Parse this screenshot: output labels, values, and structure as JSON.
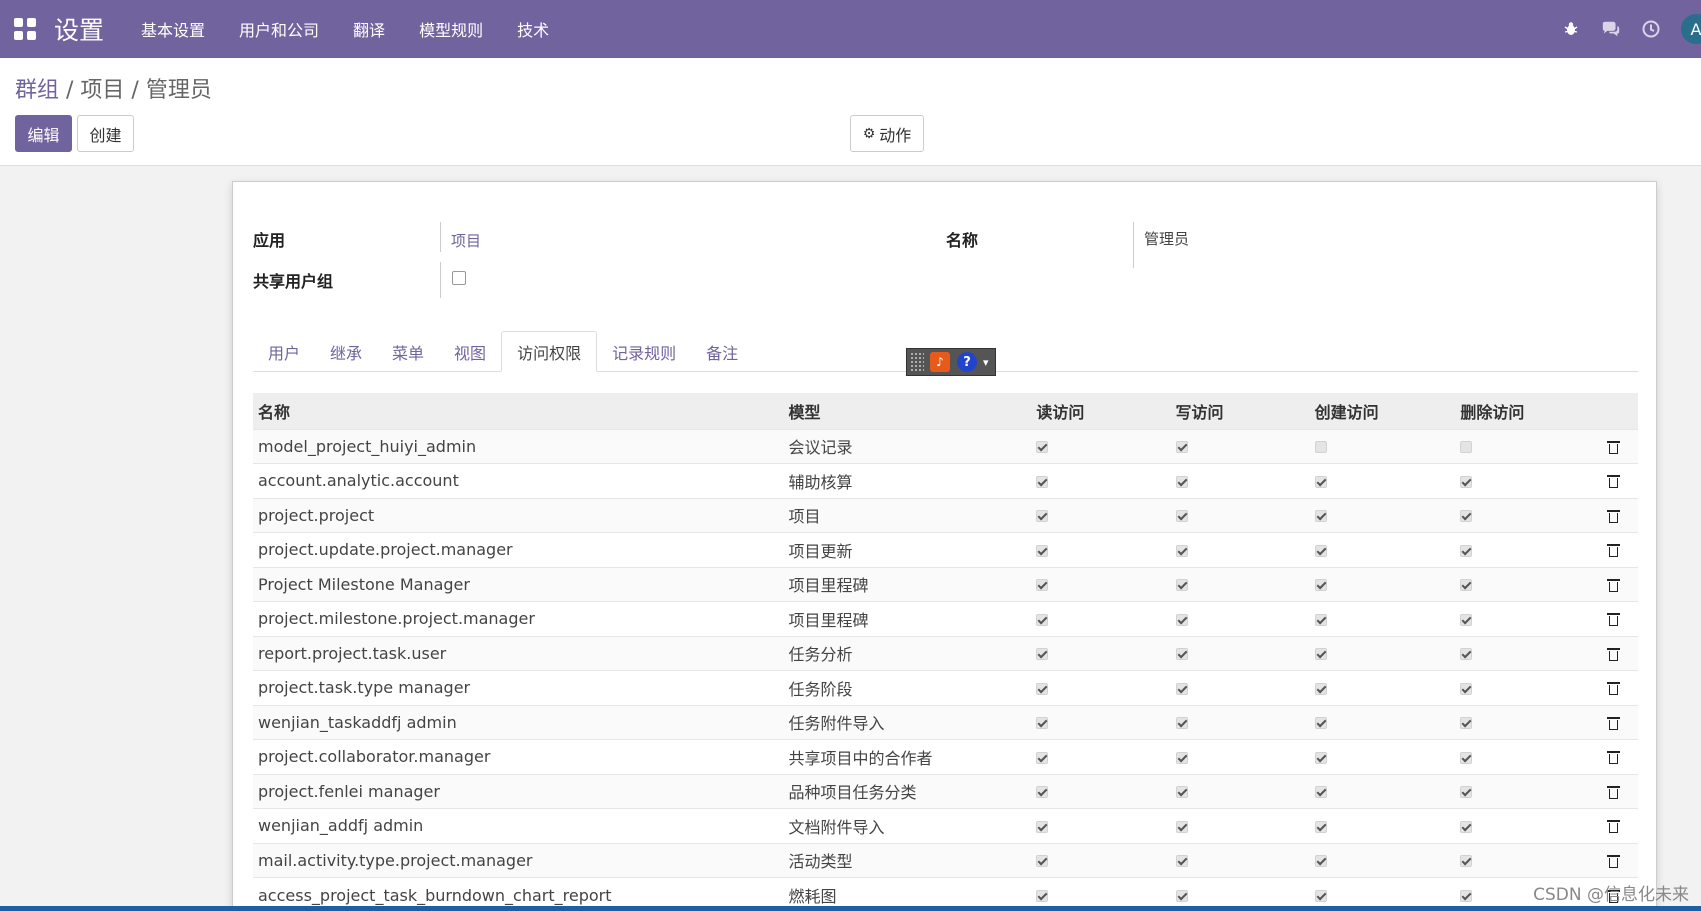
{
  "navbar": {
    "app_title": "设置",
    "menu": [
      "基本设置",
      "用户和公司",
      "翻译",
      "模型规则",
      "技术"
    ],
    "right_icons": [
      "bug-icon",
      "chat-icon",
      "clock-icon"
    ],
    "avatar_initial": "A",
    "color": "#71639e"
  },
  "breadcrumb": {
    "root": "群组",
    "sep1": " / ",
    "middle": "项目",
    "sep2": " / ",
    "current": "管理员"
  },
  "buttons": {
    "edit": "编辑",
    "create": "创建",
    "action": "动作"
  },
  "form": {
    "app_label": "应用",
    "app_value": "项目",
    "name_label": "名称",
    "name_value": "管理员",
    "shared_label": "共享用户组",
    "shared_checked": false
  },
  "tabs": [
    {
      "label": "用户",
      "active": false
    },
    {
      "label": "继承",
      "active": false
    },
    {
      "label": "菜单",
      "active": false
    },
    {
      "label": "视图",
      "active": false
    },
    {
      "label": "访问权限",
      "active": true
    },
    {
      "label": "记录规则",
      "active": false
    },
    {
      "label": "备注",
      "active": false
    }
  ],
  "table": {
    "headers": [
      "名称",
      "模型",
      "读访问",
      "写访问",
      "创建访问",
      "删除访问",
      ""
    ],
    "rows": [
      {
        "name": "model_project_huiyi_admin",
        "model": "会议记录",
        "read": true,
        "write": true,
        "create": false,
        "unlink": false
      },
      {
        "name": "account.analytic.account",
        "model": "辅助核算",
        "read": true,
        "write": true,
        "create": true,
        "unlink": true
      },
      {
        "name": "project.project",
        "model": "项目",
        "read": true,
        "write": true,
        "create": true,
        "unlink": true
      },
      {
        "name": "project.update.project.manager",
        "model": "项目更新",
        "read": true,
        "write": true,
        "create": true,
        "unlink": true
      },
      {
        "name": "Project Milestone Manager",
        "model": "项目里程碑",
        "read": true,
        "write": true,
        "create": true,
        "unlink": true
      },
      {
        "name": "project.milestone.project.manager",
        "model": "项目里程碑",
        "read": true,
        "write": true,
        "create": true,
        "unlink": true
      },
      {
        "name": "report.project.task.user",
        "model": "任务分析",
        "read": true,
        "write": true,
        "create": true,
        "unlink": true
      },
      {
        "name": "project.task.type manager",
        "model": "任务阶段",
        "read": true,
        "write": true,
        "create": true,
        "unlink": true
      },
      {
        "name": "wenjian_taskaddfj admin",
        "model": "任务附件导入",
        "read": true,
        "write": true,
        "create": true,
        "unlink": true
      },
      {
        "name": "project.collaborator.manager",
        "model": "共享项目中的合作者",
        "read": true,
        "write": true,
        "create": true,
        "unlink": true
      },
      {
        "name": "project.fenlei manager",
        "model": "品种项目任务分类",
        "read": true,
        "write": true,
        "create": true,
        "unlink": true
      },
      {
        "name": "wenjian_addfj admin",
        "model": "文档附件导入",
        "read": true,
        "write": true,
        "create": true,
        "unlink": true
      },
      {
        "name": "mail.activity.type.project.manager",
        "model": "活动类型",
        "read": true,
        "write": true,
        "create": true,
        "unlink": true
      },
      {
        "name": "access_project_task_burndown_chart_report",
        "model": "燃耗图",
        "read": true,
        "write": true,
        "create": true,
        "unlink": true
      }
    ]
  },
  "watermark": "CSDN @信息化未来"
}
